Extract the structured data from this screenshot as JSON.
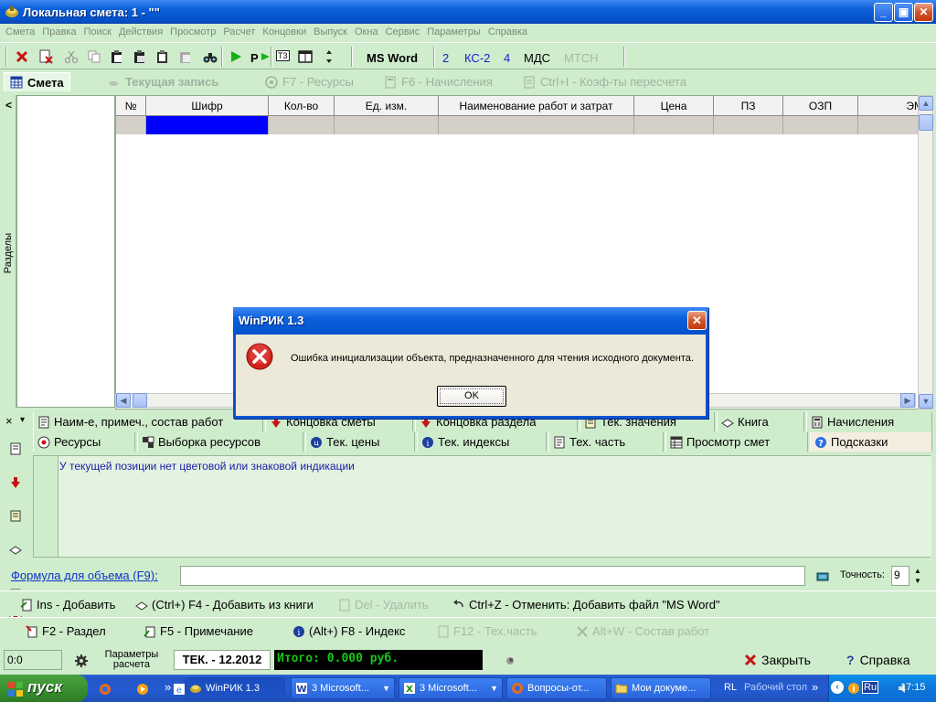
{
  "window": {
    "title": "Локальная смета: 1 - \"\"",
    "buttons": {
      "minimize": "_",
      "maximize": "▣",
      "close": "✕"
    }
  },
  "menu": [
    "Смета",
    "Правка",
    "Поиск",
    "Действия",
    "Просмотр",
    "Расчет",
    "Концовки",
    "Выпуск",
    "Окна",
    "Сервис",
    "Параметры",
    "Справка"
  ],
  "toolbar": {
    "ms_word": "MS Word",
    "btn_2": "2",
    "ks2": "КС-2",
    "btn_4": "4",
    "mds": "МДС",
    "mtsn": "МТСН",
    "t3": "Т3",
    "p_label": "P"
  },
  "tabs": [
    {
      "label": "Смета",
      "active": true
    },
    {
      "label": "Текущая запись",
      "active": false
    },
    {
      "label": "F7 - Ресурсы",
      "active": false
    },
    {
      "label": "F6 - Начисления",
      "active": false
    },
    {
      "label": "Ctrl+I - Коэф-ты пересчета",
      "active": false
    }
  ],
  "left_panel": {
    "label": "Разделы",
    "collapse": "<"
  },
  "grid": {
    "columns": [
      "№",
      "Шифр",
      "Кол-во",
      "Ед. изм.",
      "Наименование работ и затрат",
      "Цена",
      "ПЗ",
      "ОЗП",
      "ЭМ"
    ]
  },
  "bottom_tabs": {
    "close": "×",
    "row1": [
      "Наим-е, примеч., состав работ",
      "Концовка сметы",
      "Концовка раздела",
      "Тек. значения",
      "Книга",
      "Начисления"
    ],
    "row2": [
      "Ресурсы",
      "Выборка ресурсов",
      "Тек. цены",
      "Тек. индексы",
      "Тех. часть",
      "Просмотр смет",
      "Подсказки"
    ]
  },
  "hint_text": "У текущей позиции нет цветовой или знаковой индикации",
  "formula": {
    "label": "Формула для объема (F9):",
    "value": "",
    "precision_label": "Точность:",
    "precision_value": "9"
  },
  "actions_row1": [
    {
      "label": "Ins - Добавить",
      "enabled": true
    },
    {
      "label": "(Ctrl+) F4 - Добавить из книги",
      "enabled": true
    },
    {
      "label": "Del - Удалить",
      "enabled": false
    },
    {
      "label": "Ctrl+Z - Отменить: Добавить файл \"MS Word\"",
      "enabled": true
    }
  ],
  "actions_row2": [
    {
      "label": "F2 - Раздел",
      "enabled": true
    },
    {
      "label": "F5 - Примечание",
      "enabled": true
    },
    {
      "label": "(Alt+) F8 - Индекс",
      "enabled": true
    },
    {
      "label": "F12 - Тех.часть",
      "enabled": false
    },
    {
      "label": "Alt+W - Состав работ",
      "enabled": false
    }
  ],
  "status": {
    "coord": "0:0",
    "params_line1": "Параметры",
    "params_line2": "расчета",
    "tek": "ТЕК. - 12.2012",
    "total": "Итого: 0.000 руб.",
    "close": "Закрыть",
    "help": "Справка"
  },
  "dialog": {
    "title": "WinРИК 1.3",
    "message": "Ошибка инициализации объекта, предназначенного для чтения исходного документа.",
    "ok": "OK",
    "close": "✕"
  },
  "taskbar": {
    "start": "пуск",
    "quicklaunch_more": "»",
    "tasks": [
      {
        "label": "WinРИК 1.3",
        "active": true
      },
      {
        "label": "3 Microsoft...",
        "active": false
      },
      {
        "label": "3 Microsoft...",
        "active": false
      },
      {
        "label": "Вопросы-от...",
        "active": false
      },
      {
        "label": "Мои докуме...",
        "active": false
      }
    ],
    "lang_rl": "RL",
    "desktop": "Рабочий стол",
    "tray_more": "»",
    "lang": "Ru",
    "time": "17:15"
  },
  "colors": {
    "app_bg": "#cfeccc",
    "title_blue": "#0a5fd8",
    "selection": "#0000ff",
    "total_bg": "#000000",
    "total_fg": "#17c617",
    "hint_fg": "#1919a8",
    "error_red": "#d2231e"
  }
}
